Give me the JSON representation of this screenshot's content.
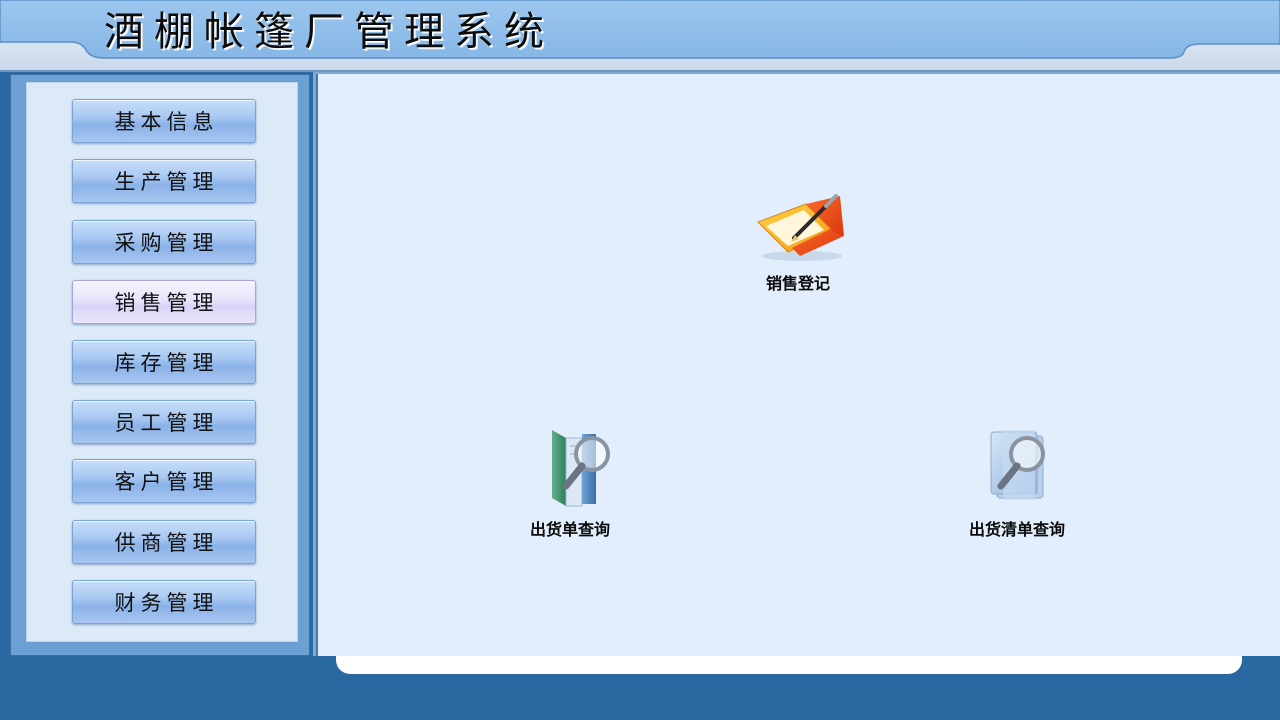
{
  "header": {
    "title": "酒棚帐篷厂管理系统"
  },
  "sidebar": {
    "items": [
      {
        "label": "基本信息"
      },
      {
        "label": "生产管理"
      },
      {
        "label": "采购管理"
      },
      {
        "label": "销售管理"
      },
      {
        "label": "库存管理"
      },
      {
        "label": "员工管理"
      },
      {
        "label": "客户管理"
      },
      {
        "label": "供商管理"
      },
      {
        "label": "财务管理"
      }
    ],
    "active_index": 3
  },
  "main": {
    "shortcuts": [
      {
        "label": "销售登记",
        "icon": "sales-register-icon"
      },
      {
        "label": "出货单查询",
        "icon": "shipment-query-icon"
      },
      {
        "label": "出货清单查询",
        "icon": "shipment-list-query-icon"
      }
    ]
  },
  "colors": {
    "header_bg": "#8ebde9",
    "sidebar_frame": "#6c9fd3",
    "main_bg": "#e2eefc",
    "bottom_band": "#2a68a2",
    "active_button": "#e8e4fb"
  }
}
